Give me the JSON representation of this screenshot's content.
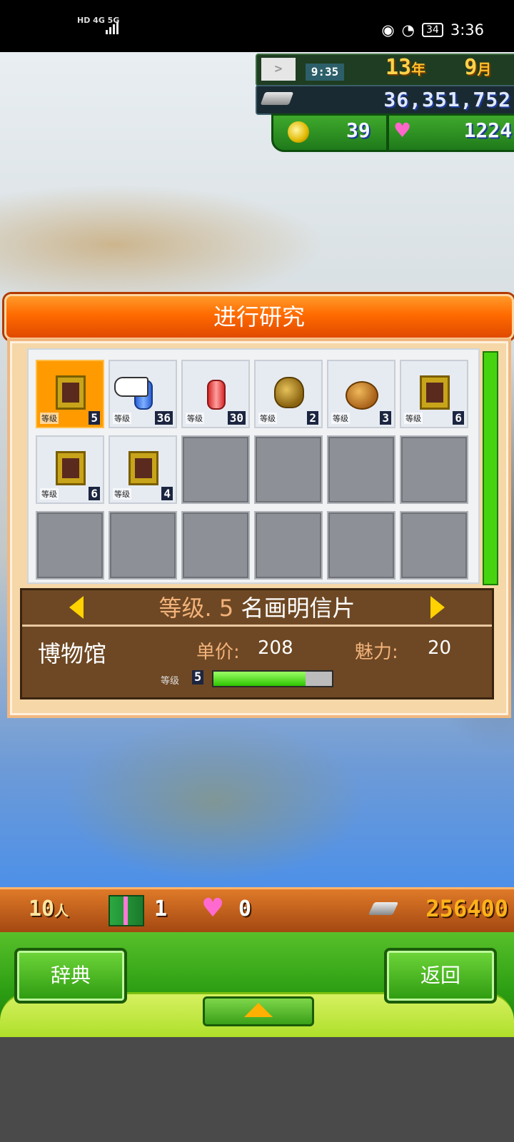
{
  "status_bar": {
    "network_left": "HD 4G 5G",
    "battery": "34",
    "time": "3:36"
  },
  "hud": {
    "time": "9:35",
    "year": "13",
    "year_unit": "年",
    "month": "9",
    "month_unit": "月",
    "money": "36,351,752",
    "coins": "39",
    "charm": "1224"
  },
  "dialog": {
    "title": "进行研究",
    "level_tag": "等级",
    "items": [
      {
        "icon": "painting-postcard-icon",
        "level": "5",
        "selected": true
      },
      {
        "icon": "blue-capsule-icon",
        "level": "36"
      },
      {
        "icon": "red-capsule-icon",
        "level": "30"
      },
      {
        "icon": "vase-icon",
        "level": "2"
      },
      {
        "icon": "pot-icon",
        "level": "3"
      },
      {
        "icon": "painting-postcard-icon",
        "level": "6"
      },
      {
        "icon": "painting-postcard-icon",
        "level": "6"
      },
      {
        "icon": "painting-postcard-icon",
        "level": "4"
      }
    ],
    "detail": {
      "level_prefix": "等级. 5",
      "item_name": "名画明信片",
      "facility": "博物馆",
      "price_label": "单价:",
      "price_value": "208",
      "charm_label": "魅力:",
      "charm_value": "20",
      "level_tag": "等级",
      "level_value": "5",
      "level_progress": 0.78
    }
  },
  "bottom_bar": {
    "people": "10",
    "people_unit": "人",
    "gifts": "1",
    "hearts": "0",
    "money": "256400"
  },
  "menu": {
    "dictionary_label": "辞典",
    "back_label": "返回"
  },
  "colors": {
    "accent_orange": "#ff6a00",
    "menu_green": "#2ea014",
    "panel_brown": "#6e4824"
  }
}
